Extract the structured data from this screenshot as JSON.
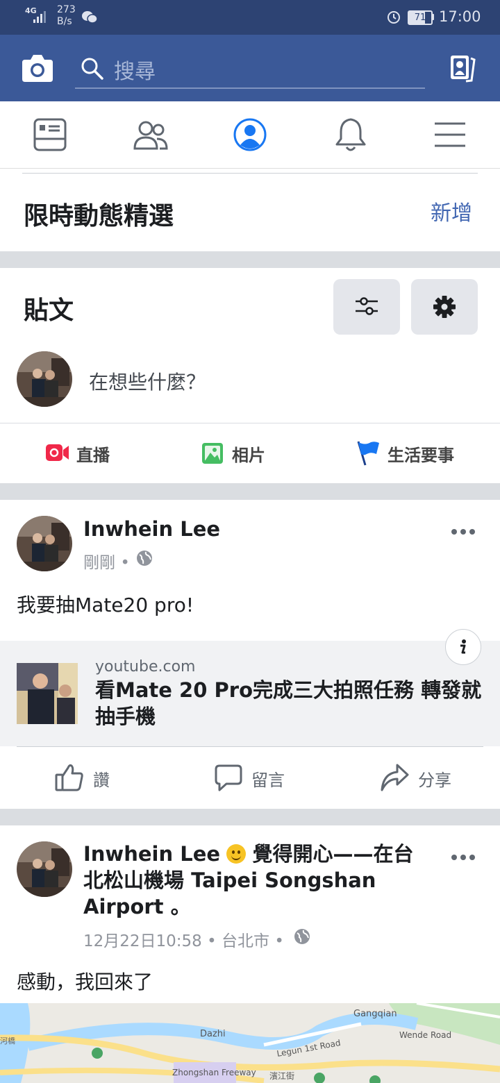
{
  "status_bar": {
    "network": "4G",
    "speed_value": "273",
    "speed_unit": "B/s",
    "battery": "71",
    "battery_level": 0.71,
    "time": "17:00"
  },
  "header": {
    "search_placeholder": "搜尋"
  },
  "highlights": {
    "title": "限時動態精選",
    "add_label": "新增"
  },
  "posts_section": {
    "title": "貼文",
    "composer_prompt": "在想些什麼？",
    "actions": {
      "live": "直播",
      "photo": "相片",
      "life_event": "生活要事"
    }
  },
  "post1": {
    "author": "Inwhein Lee",
    "time": "剛剛",
    "separator": "•",
    "text": "我要抽Mate20 pro!",
    "link": {
      "domain": "youtube.com",
      "title": "看Mate 20 Pro完成三大拍照任務 轉發就抽手機"
    },
    "reactions": {
      "like": "讚",
      "comment": "留言",
      "share": "分享"
    }
  },
  "post2": {
    "author": "Inwhein Lee",
    "feeling": "覺得開心——在台北松山機場 Taipei Songshan Airport 。",
    "time": "12月22日10:58",
    "separator": "•",
    "location": "台北市",
    "separator2": "•",
    "text": "感動，我回來了"
  },
  "map": {
    "labels": {
      "gangqian": "Gangqian",
      "dazhi": "Dazhi",
      "wende": "Wende Road",
      "legun": "Legun 1st Road",
      "zhongshan": "Zhongshan Freeway",
      "binjiang": "濱江街",
      "hekou": "河橋"
    }
  },
  "colors": {
    "brand": "#3b5998",
    "status_bar": "#2d4373",
    "link_blue": "#4267b2",
    "live_red": "#f02849",
    "photo_green": "#45bd62",
    "flag_blue": "#1877f2"
  }
}
